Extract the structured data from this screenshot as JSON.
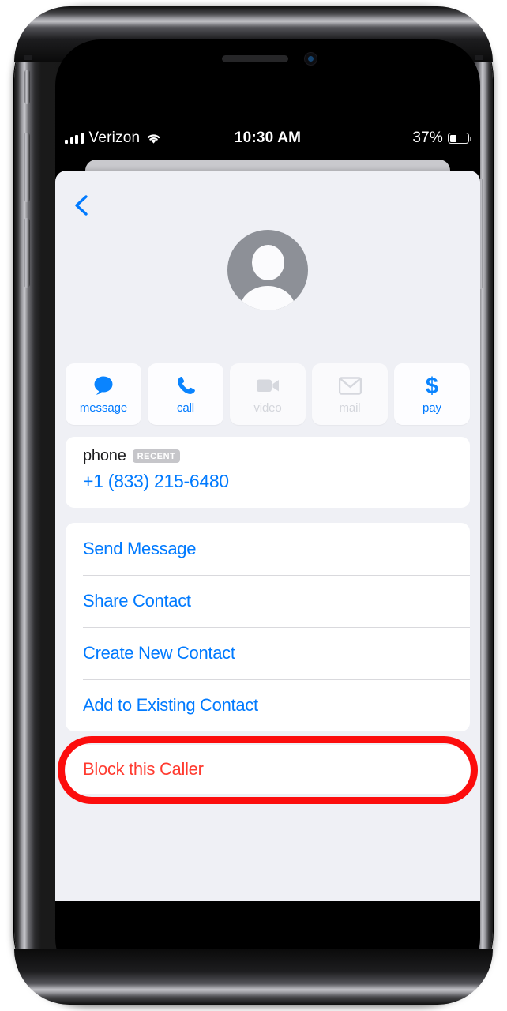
{
  "status_bar": {
    "carrier": "Verizon",
    "time": "10:30 AM",
    "battery_percent": "37%",
    "battery_level_pct": 37,
    "signal_bars": 4,
    "wifi_icon": "wifi-icon"
  },
  "sheet": {
    "back_icon": "chevron-left-icon",
    "avatar_icon": "person-placeholder-avatar"
  },
  "quick_actions": [
    {
      "label": "message",
      "icon": "message-bubble-icon",
      "enabled": true
    },
    {
      "label": "call",
      "icon": "phone-handset-icon",
      "enabled": true
    },
    {
      "label": "video",
      "icon": "video-camera-icon",
      "enabled": false
    },
    {
      "label": "mail",
      "icon": "envelope-icon",
      "enabled": false
    },
    {
      "label": "pay",
      "icon": "dollar-sign-icon",
      "enabled": true
    }
  ],
  "phone_card": {
    "label": "phone",
    "badge": "RECENT",
    "number": "+1 (833) 215-6480"
  },
  "action_list": [
    {
      "label": "Send Message"
    },
    {
      "label": "Share Contact"
    },
    {
      "label": "Create New Contact"
    },
    {
      "label": "Add to Existing Contact"
    }
  ],
  "block_action": {
    "label": "Block this Caller"
  },
  "colors": {
    "ios_blue": "#007aff",
    "destructive_red": "#ff3b30",
    "annotation_red": "#fc0d0d",
    "sheet_background": "#eff0f5",
    "card_white": "#ffffff",
    "disabled_gray": "#d3d5db",
    "badge_gray": "#c6c6ca",
    "avatar_gray": "#8d9097"
  }
}
